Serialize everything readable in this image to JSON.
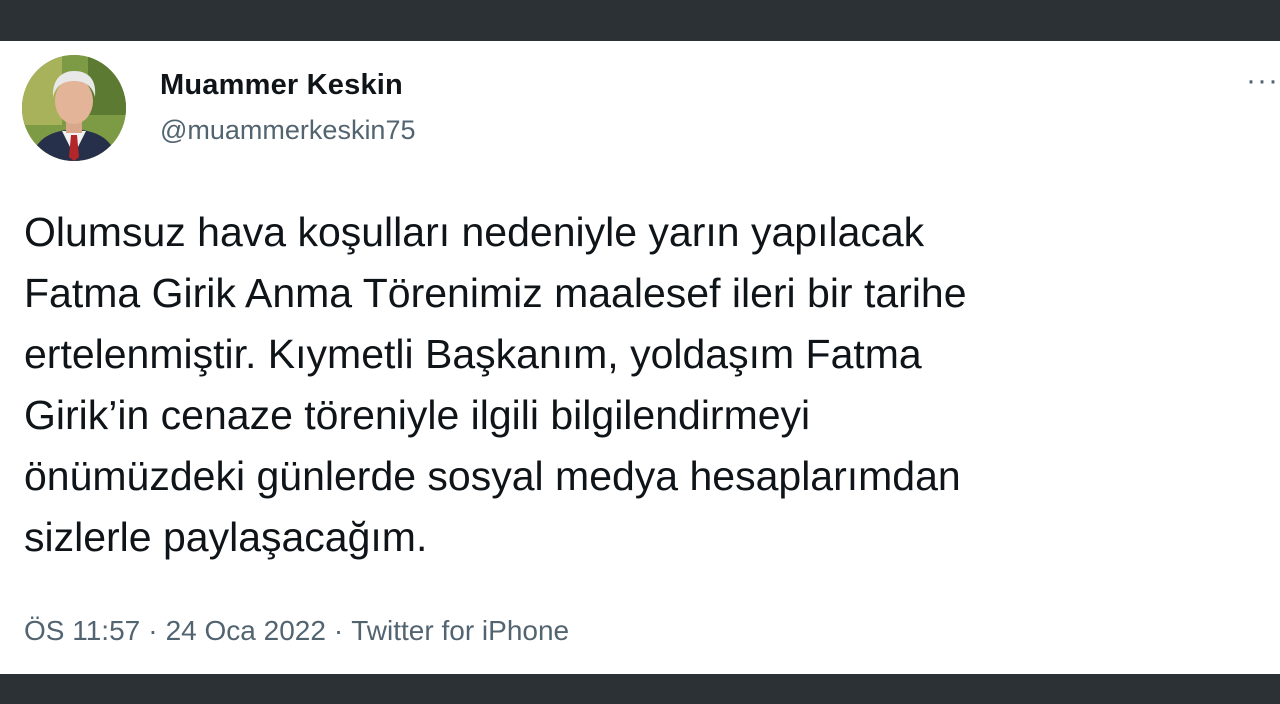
{
  "author": {
    "display_name": "Muammer Keskin",
    "handle": "@muammerkeskin75",
    "avatar_icon": "profile-photo"
  },
  "more_icon": "more-options-icon",
  "more_label": "···",
  "tweet": {
    "text": "Olumsuz hava koşulları nedeniyle yarın yapılacak\nFatma Girik Anma Törenimiz maalesef ileri bir tarihe\nertelenmiştir. Kıymetli Başkanım, yoldaşım Fatma\nGirik’in cenaze töreniyle ilgili bilgilendirmeyi\nönümüzdeki günlerde sosyal medya hesaplarımdan\nsizlerle paylaşacağım.",
    "time": "ÖS 11:57",
    "date": "24 Oca 2022",
    "source": "Twitter for iPhone",
    "separator": "·"
  },
  "colors": {
    "frame": "#2b3135",
    "card": "#ffffff",
    "text": "#0f1419",
    "secondary": "#536471"
  }
}
